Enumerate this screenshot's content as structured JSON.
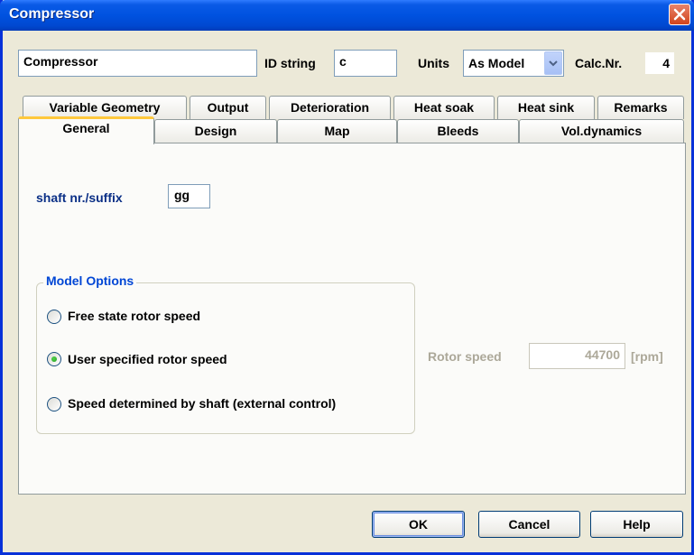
{
  "window": {
    "title": "Compressor"
  },
  "header": {
    "name_value": "Compressor",
    "id_label": "ID string",
    "id_value": "c",
    "units_label": "Units",
    "units_value": "As Model",
    "calc_label": "Calc.Nr.",
    "calc_value": "4"
  },
  "tabs": {
    "row1": [
      "Variable Geometry",
      "Output",
      "Deterioration",
      "Heat soak",
      "Heat sink",
      "Remarks"
    ],
    "row2": [
      "General",
      "Design",
      "Map",
      "Bleeds",
      "Vol.dynamics"
    ],
    "active": "General"
  },
  "general": {
    "shaft_label": "shaft nr./suffix",
    "shaft_value": "gg",
    "group_title": "Model Options",
    "options": [
      {
        "label": "Free state rotor speed",
        "selected": false
      },
      {
        "label": "User specified rotor speed",
        "selected": true
      },
      {
        "label": "Speed determined by shaft (external control)",
        "selected": false
      }
    ],
    "rotor_label": "Rotor speed",
    "rotor_value": "44700",
    "rotor_unit": "[rpm]"
  },
  "buttons": {
    "ok": "OK",
    "cancel": "Cancel",
    "help": "Help"
  },
  "colors": {
    "titlebar": "#0052e0",
    "accent_tab": "#ffc83c",
    "group_title": "#0046d5"
  }
}
